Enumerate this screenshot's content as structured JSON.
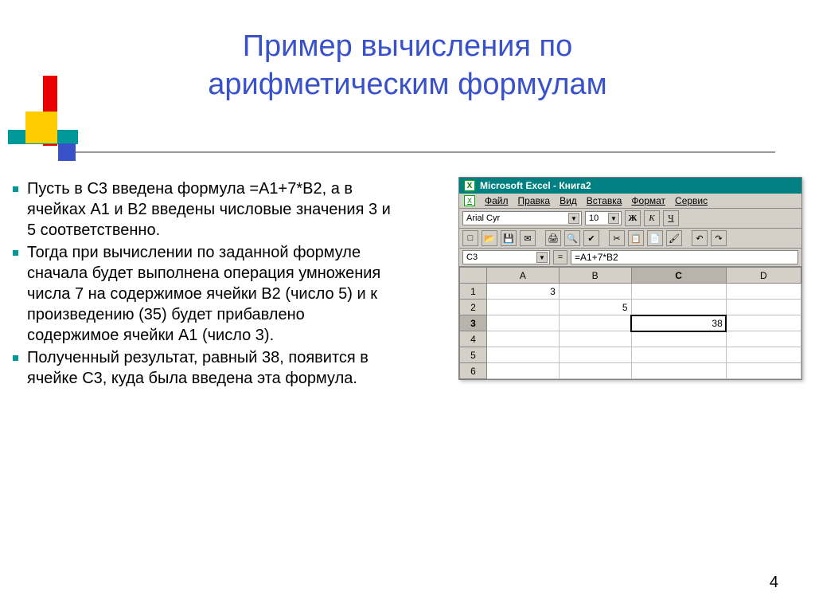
{
  "title_line1": "Пример вычисления по",
  "title_line2": "арифметическим формулам",
  "bullets": [
    "Пусть в C3 введена формула =A1+7*B2, а в ячейках A1 и B2 введены числовые значения 3 и 5 соответственно.",
    "Тогда при вычислении по заданной формуле сначала будет выполнена операция умножения числа 7 на содержимое ячейки B2 (число 5) и к произведению (35) будет прибавлено содержимое ячейки A1 (число 3).",
    "Полученный результат, равный 38, появится в ячейке C3, куда была введена эта формула."
  ],
  "page_number": "4",
  "excel": {
    "app_title": "Microsoft Excel - Книга2",
    "menus": [
      "Файл",
      "Правка",
      "Вид",
      "Вставка",
      "Формат",
      "Сервис"
    ],
    "font_name": "Arial Cyr",
    "font_size": "10",
    "style_bold": "Ж",
    "style_italic": "К",
    "style_underline": "Ч",
    "namebox": "C3",
    "eq_label": "=",
    "formula": "=A1+7*B2",
    "columns": [
      "A",
      "B",
      "C",
      "D"
    ],
    "rows": [
      "1",
      "2",
      "3",
      "4",
      "5",
      "6"
    ],
    "cells": {
      "A1": "3",
      "B2": "5",
      "C3": "38"
    },
    "selected_col": "C",
    "selected_row": "3"
  }
}
